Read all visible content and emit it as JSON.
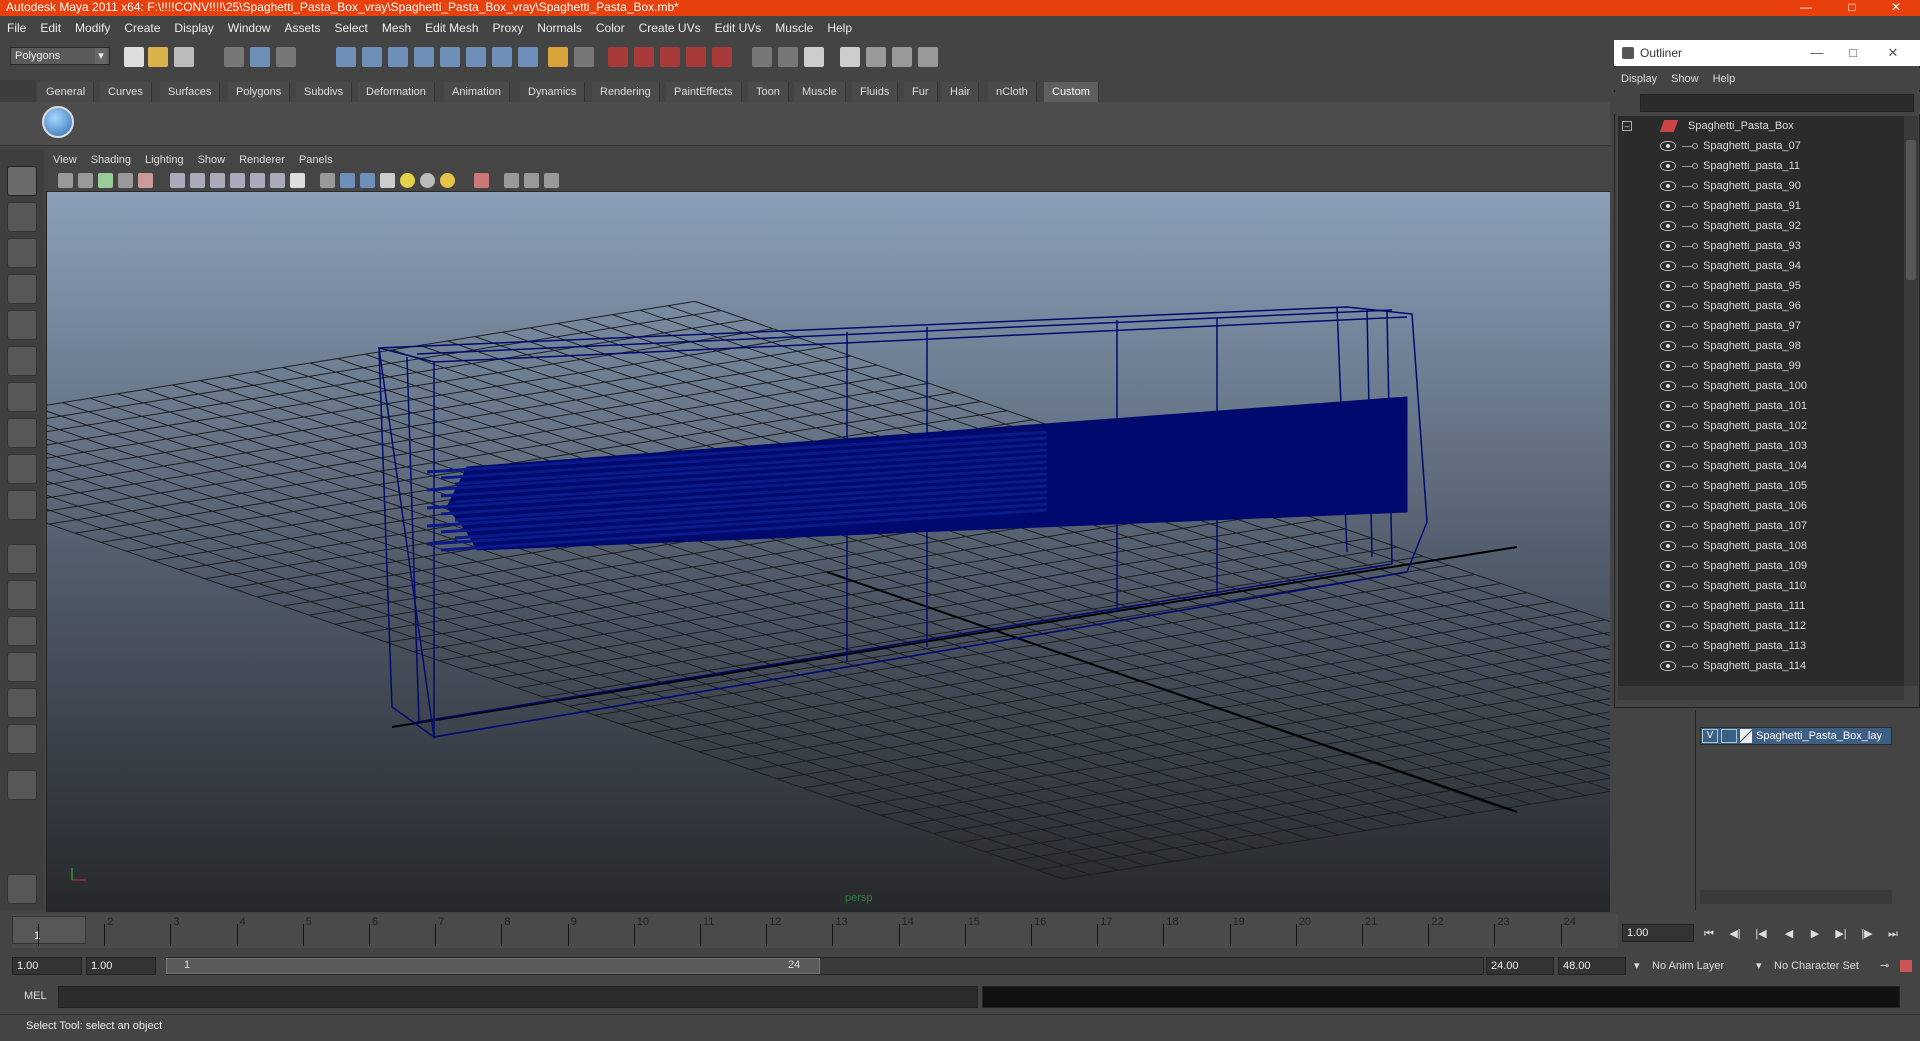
{
  "window": {
    "title": "Autodesk Maya 2011 x64: F:\\!!!!CONV!!!!\\25\\Spaghetti_Pasta_Box_vray\\Spaghetti_Pasta_Box_vray\\Spaghetti_Pasta_Box.mb*"
  },
  "menubar": [
    "File",
    "Edit",
    "Modify",
    "Create",
    "Display",
    "Window",
    "Assets",
    "Select",
    "Mesh",
    "Edit Mesh",
    "Proxy",
    "Normals",
    "Color",
    "Create UVs",
    "Edit UVs",
    "Muscle",
    "Help"
  ],
  "mode_selector": {
    "value": "Polygons"
  },
  "shelf_tabs": [
    "General",
    "Curves",
    "Surfaces",
    "Polygons",
    "Subdivs",
    "Deformation",
    "Animation",
    "Dynamics",
    "Rendering",
    "PaintEffects",
    "Toon",
    "Muscle",
    "Fluids",
    "Fur",
    "Hair",
    "nCloth",
    "Custom"
  ],
  "shelf_active_tab": "Custom",
  "viewport": {
    "menu": [
      "View",
      "Shading",
      "Lighting",
      "Show",
      "Renderer",
      "Panels"
    ],
    "camera_label": "persp",
    "wire_color": "#000a6e",
    "gradient_top": "#8a9fb8",
    "gradient_bottom": "#2a2c30"
  },
  "outliner": {
    "title": "Outliner",
    "menu": [
      "Display",
      "Show",
      "Help"
    ],
    "root": "Spaghetti_Pasta_Box",
    "items": [
      "Spaghetti_pasta_07",
      "Spaghetti_pasta_11",
      "Spaghetti_pasta_90",
      "Spaghetti_pasta_91",
      "Spaghetti_pasta_92",
      "Spaghetti_pasta_93",
      "Spaghetti_pasta_94",
      "Spaghetti_pasta_95",
      "Spaghetti_pasta_96",
      "Spaghetti_pasta_97",
      "Spaghetti_pasta_98",
      "Spaghetti_pasta_99",
      "Spaghetti_pasta_100",
      "Spaghetti_pasta_101",
      "Spaghetti_pasta_102",
      "Spaghetti_pasta_103",
      "Spaghetti_pasta_104",
      "Spaghetti_pasta_105",
      "Spaghetti_pasta_106",
      "Spaghetti_pasta_107",
      "Spaghetti_pasta_108",
      "Spaghetti_pasta_109",
      "Spaghetti_pasta_110",
      "Spaghetti_pasta_111",
      "Spaghetti_pasta_112",
      "Spaghetti_pasta_113",
      "Spaghetti_pasta_114"
    ]
  },
  "layers": {
    "visible_flag": "V",
    "layer_name": "Spaghetti_Pasta_Box_lay"
  },
  "timeline": {
    "frames": [
      "1",
      "2",
      "3",
      "4",
      "5",
      "6",
      "7",
      "8",
      "9",
      "10",
      "11",
      "12",
      "13",
      "14",
      "15",
      "16",
      "17",
      "18",
      "19",
      "20",
      "21",
      "22",
      "23",
      "24"
    ],
    "current_frame": "1",
    "current_time_field": "1.00"
  },
  "range": {
    "start_time": "1.00",
    "playback_start": "1.00",
    "slider_start": "1",
    "slider_end": "24",
    "playback_end": "24.00",
    "end_time": "48.00",
    "anim_layer": "No Anim Layer",
    "character_set": "No Character Set"
  },
  "command_line": {
    "label": "MEL"
  },
  "help_line": {
    "text": "Select Tool: select an object"
  }
}
